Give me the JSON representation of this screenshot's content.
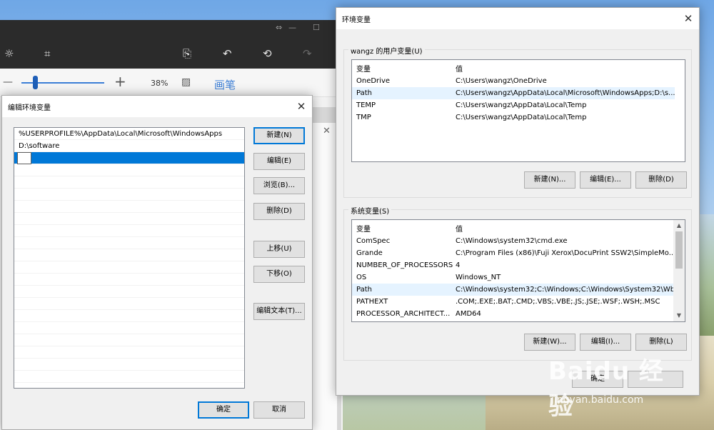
{
  "paint": {
    "toolbar_icons": [
      "brightness-icon",
      "crop-icon",
      "paste-icon",
      "undo-icon",
      "history-icon",
      "redo-icon"
    ],
    "zoom_value": "38%",
    "brush_label": "画笔"
  },
  "env_window": {
    "title": "环境变量",
    "user_group_label": "wangz 的用户变量(U)",
    "system_group_label": "系统变量(S)",
    "col_var": "变量",
    "col_val": "值",
    "user_vars": [
      {
        "name": "OneDrive",
        "value": "C:\\Users\\wangz\\OneDrive"
      },
      {
        "name": "Path",
        "value": "C:\\Users\\wangz\\AppData\\Local\\Microsoft\\WindowsApps;D:\\s..."
      },
      {
        "name": "TEMP",
        "value": "C:\\Users\\wangz\\AppData\\Local\\Temp"
      },
      {
        "name": "TMP",
        "value": "C:\\Users\\wangz\\AppData\\Local\\Temp"
      }
    ],
    "system_vars": [
      {
        "name": "ComSpec",
        "value": "C:\\Windows\\system32\\cmd.exe"
      },
      {
        "name": "Grande",
        "value": "C:\\Program Files (x86)\\Fuji Xerox\\DocuPrint SSW2\\SimpleMo..."
      },
      {
        "name": "NUMBER_OF_PROCESSORS",
        "value": "4"
      },
      {
        "name": "OS",
        "value": "Windows_NT"
      },
      {
        "name": "Path",
        "value": "C:\\Windows\\system32;C:\\Windows;C:\\Windows\\System32\\Wb..."
      },
      {
        "name": "PATHEXT",
        "value": ".COM;.EXE;.BAT;.CMD;.VBS;.VBE;.JS;.JSE;.WSF;.WSH;.MSC"
      },
      {
        "name": "PROCESSOR_ARCHITECT...",
        "value": "AMD64"
      }
    ],
    "user_buttons": {
      "new": "新建(N)...",
      "edit": "编辑(E)...",
      "delete": "删除(D)"
    },
    "system_buttons": {
      "new": "新建(W)...",
      "edit": "编辑(I)...",
      "delete": "删除(L)"
    },
    "ok_label": "确定"
  },
  "edit_dialog": {
    "title": "编辑环境变量",
    "entries": [
      "%USERPROFILE%\\AppData\\Local\\Microsoft\\WindowsApps",
      "D:\\software"
    ],
    "buttons": {
      "new": "新建(N)",
      "edit": "编辑(E)",
      "browse": "浏览(B)...",
      "delete": "删除(D)",
      "move_up": "上移(U)",
      "move_down": "下移(O)",
      "edit_text": "编辑文本(T)..."
    },
    "ok_label": "确定",
    "cancel_label": "取消"
  },
  "watermark": {
    "text": "Baidu 经验",
    "sub": "jingyan.baidu.com"
  },
  "colors": {
    "accent": "#0078d7",
    "selection": "#e5f3ff",
    "toolbar": "#2b2b2b",
    "brush": "#3b7ed6"
  }
}
